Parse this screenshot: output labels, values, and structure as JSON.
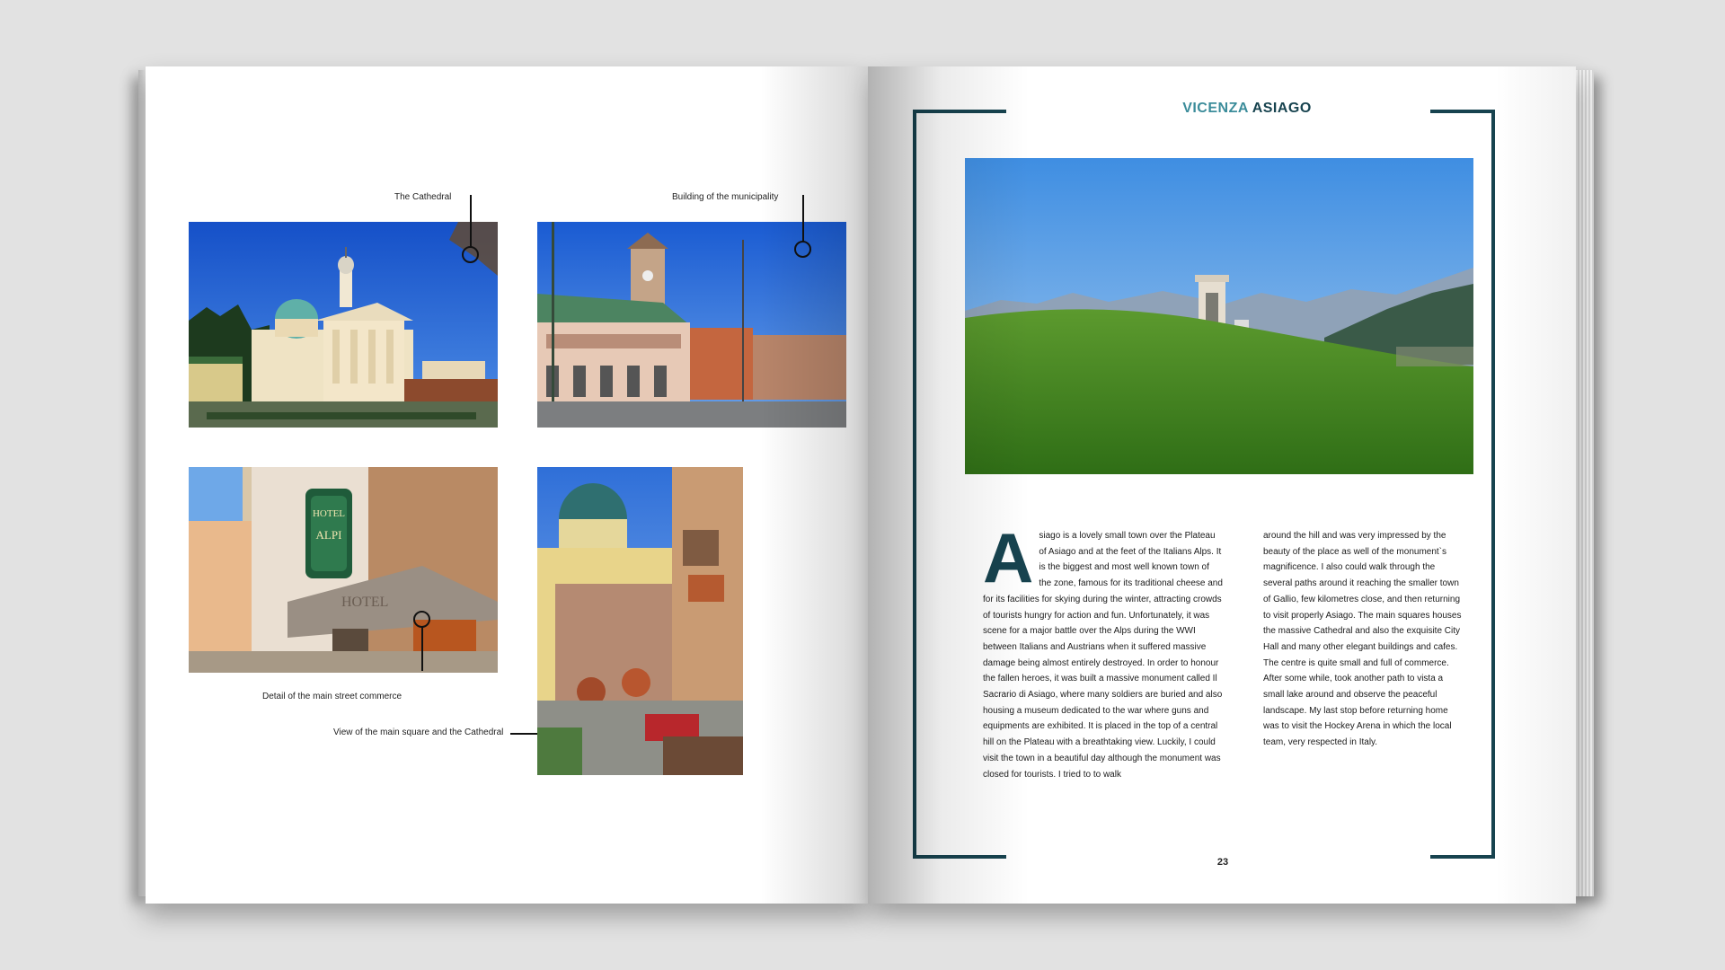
{
  "left_page": {
    "captions": {
      "cathedral": "The Cathedral",
      "municipality": "Building of the municipality",
      "street": "Detail of the main street commerce",
      "square": "View of the main square and the Cathedral"
    },
    "hotel_sign": "HOTEL ALPI"
  },
  "right_page": {
    "heading_1": "VICENZA",
    "heading_2": "ASIAGO",
    "drop_cap": "A",
    "column_1": "siago is a lovely small town over the Plateau of Asiago and at the feet of the Italians Alps. It is the biggest and most well known town of the zone, famous for its traditional cheese and for its facilities for skying during the winter, attracting crowds of tourists hungry for action and fun. Unfortunately, it was scene for a major battle over the Alps during the WWI between Italians and Austrians when it suffered massive damage being almost entirely destroyed. In order to honour the fallen heroes, it was built a massive monument called Il Sacrario di Asiago, where many soldiers are buried and also housing a museum dedicated to the war where guns and equipments are exhibited. It is placed in the top of a central hill on the Plateau with a breathtaking view. Luckily, I could visit the town in a beautiful day although the monument was closed for tourists. I tried to to walk",
    "column_2": "around the hill and was very impressed by the beauty of the place as well of the monument`s magnificence. I also could walk through the several paths around it reaching the smaller town of Gallio, few kilometres close, and then returning to visit properly Asiago. The main squares houses the massive Cathedral and also the exquisite City Hall and many other elegant buildings and cafes. The centre is quite small and full of commerce. After some while, took another path to vista a small lake around and observe the peaceful landscape. My last stop before returning home was to visit the Hockey Arena in which the local team, very respected in Italy.",
    "page_number": "23"
  },
  "colors": {
    "frame": "#17434f",
    "heading_light": "#3b8c9a",
    "heading_dark": "#17434f",
    "background": "#e2e2e2"
  }
}
